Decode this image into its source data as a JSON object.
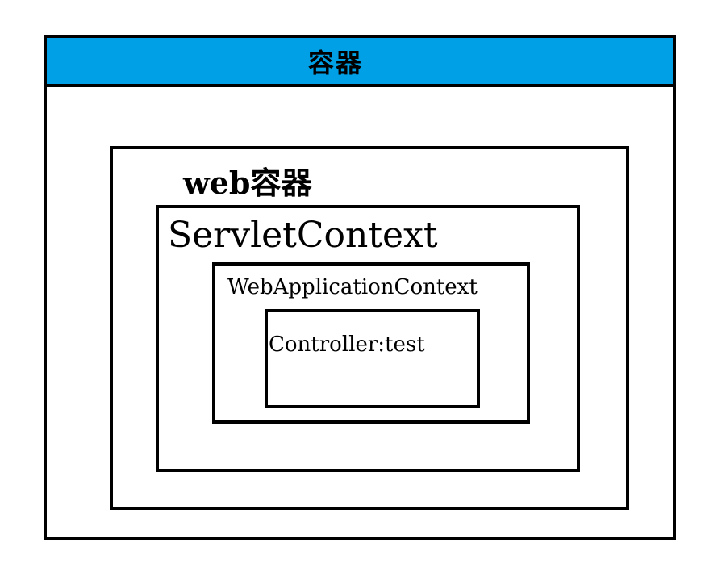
{
  "colors": {
    "header_fill": "#00a0e6",
    "border": "#000000",
    "background": "#ffffff"
  },
  "containers": {
    "outer": {
      "label": "容器"
    },
    "web": {
      "label": "web容器"
    },
    "servlet_context": {
      "label": "ServletContext"
    },
    "web_application_context": {
      "label": "WebApplicationContext"
    },
    "controller": {
      "label": "Controller:test"
    }
  }
}
